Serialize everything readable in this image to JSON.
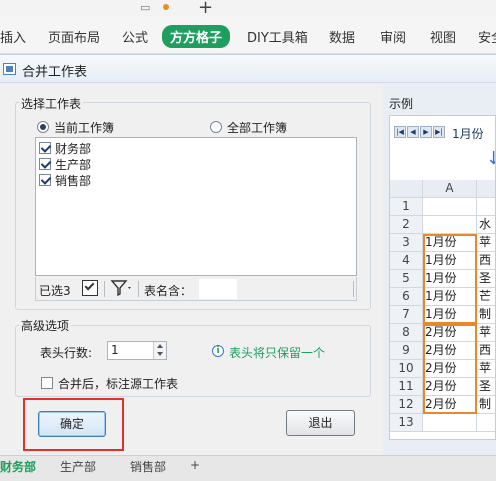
{
  "app": {
    "ribbon_tabs": [
      {
        "label": "插入"
      },
      {
        "label": "页面布局"
      },
      {
        "label": "公式"
      },
      {
        "label": "方方格子",
        "active": true
      },
      {
        "label": "DIY工具箱"
      },
      {
        "label": "数据"
      },
      {
        "label": "审阅"
      },
      {
        "label": "视图"
      },
      {
        "label": "安全"
      }
    ],
    "new_tab_symbol": "+",
    "sheet_tabs": [
      {
        "label": "财务部"
      },
      {
        "label": "生产部"
      },
      {
        "label": "销售部"
      },
      {
        "label": "+"
      }
    ]
  },
  "dialog": {
    "title": "合并工作表",
    "select_group_label": "选择工作表",
    "scope_options": [
      {
        "label": "当前工作簿",
        "selected": true
      },
      {
        "label": "全部工作簿",
        "selected": false
      }
    ],
    "sheets": [
      {
        "label": "财务部",
        "checked": true
      },
      {
        "label": "生产部",
        "checked": true
      },
      {
        "label": "销售部",
        "checked": true
      }
    ],
    "toolbar": {
      "selected_count": "已选3",
      "sheet_name_label": "表名含：",
      "sheet_name_value": ""
    },
    "advanced_group_label": "高级选项",
    "header_rows_label": "表头行数:",
    "header_rows_value": "1",
    "header_note": "表头将只保留一个",
    "mark_source_label": "合并后，标注源工作表",
    "mark_source_checked": false,
    "ok_label": "确定",
    "cancel_label": "退出",
    "example_label": "示例",
    "example_nav_tab": "1月份",
    "example_grid": {
      "column_header": "A",
      "rows": [
        {
          "row": "1",
          "a": "",
          "b": ""
        },
        {
          "row": "2",
          "a": "",
          "b": "水"
        },
        {
          "row": "3",
          "a": "1月份",
          "b": "苹"
        },
        {
          "row": "4",
          "a": "1月份",
          "b": "西"
        },
        {
          "row": "5",
          "a": "1月份",
          "b": "圣"
        },
        {
          "row": "6",
          "a": "1月份",
          "b": "芒"
        },
        {
          "row": "7",
          "a": "1月份",
          "b": "制"
        },
        {
          "row": "8",
          "a": "2月份",
          "b": "苹"
        },
        {
          "row": "9",
          "a": "2月份",
          "b": "西"
        },
        {
          "row": "10",
          "a": "2月份",
          "b": "苹"
        },
        {
          "row": "11",
          "a": "2月份",
          "b": "圣"
        },
        {
          "row": "12",
          "a": "2月份",
          "b": "制"
        },
        {
          "row": "13",
          "a": "",
          "b": ""
        }
      ]
    },
    "colors": {
      "accent_green": "#1e9e5f",
      "highlight_red": "#e03030",
      "group_orange": "#e9882b",
      "info_blue": "#3b76c6"
    }
  }
}
